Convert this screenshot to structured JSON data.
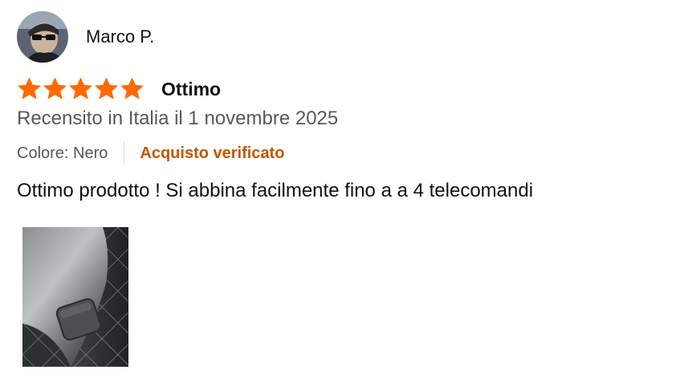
{
  "review": {
    "author": "Marco P.",
    "rating": 5,
    "rating_max": 5,
    "title": "Ottimo",
    "date": "Recensito in Italia il 1 novembre 2025",
    "variant": "Colore: Nero",
    "verified": "Acquisto verificato",
    "body": "Ottimo prodotto ! Si abbina facilmente fino a a 4 telecomandi",
    "star_color": "#ff6a00",
    "verified_color": "#c45500"
  },
  "icons": {
    "avatar": "user-avatar-photo",
    "star": "star-icon",
    "image": "review-photo"
  }
}
